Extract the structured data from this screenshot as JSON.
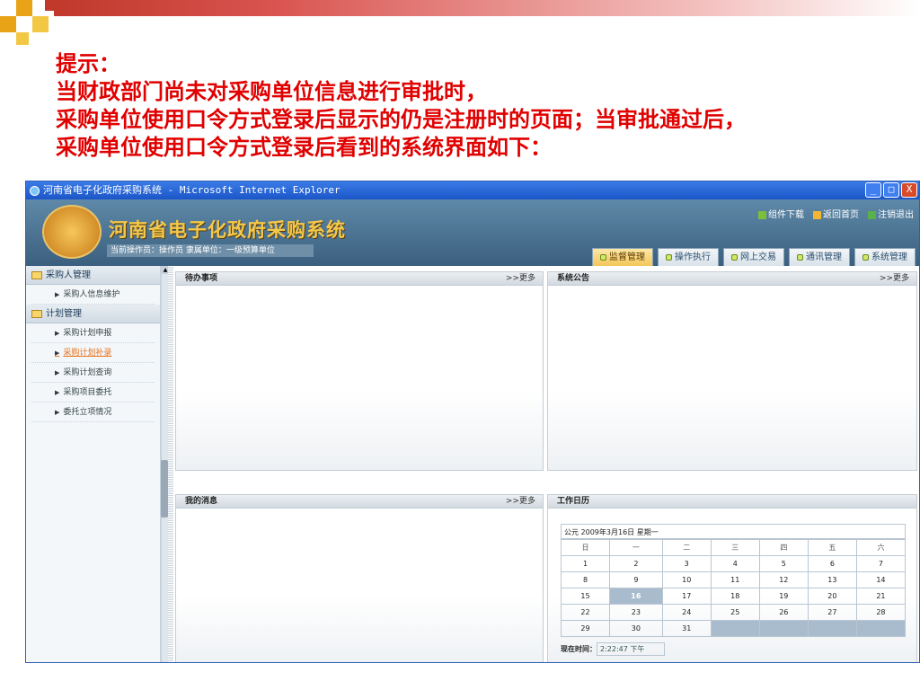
{
  "caption": {
    "line1": "提示：",
    "line2": "当财政部门尚未对采购单位信息进行审批时，",
    "line3": "采购单位使用口令方式登录后显示的仍是注册时的页面；当审批通过后，",
    "line4": "采购单位使用口令方式登录后看到的系统界面如下："
  },
  "window": {
    "title": "河南省电子化政府采购系统 - Microsoft Internet Explorer",
    "btn_min": "_",
    "btn_max": "□",
    "btn_close": "X"
  },
  "header": {
    "system_name": "河南省电子化政府采购系统",
    "operator_info": "当前操作员：操作员 隶属单位：一级预算单位",
    "links": {
      "download": "组件下载",
      "home": "返回首页",
      "logout": "注销退出"
    },
    "tabs": [
      {
        "label": "监督管理",
        "active": true
      },
      {
        "label": "操作执行",
        "active": false
      },
      {
        "label": "网上交易",
        "active": false
      },
      {
        "label": "通讯管理",
        "active": false
      },
      {
        "label": "系统管理",
        "active": false
      }
    ]
  },
  "sidebar": {
    "group1": "采购人管理",
    "group1_items": [
      "采购人信息维护"
    ],
    "group2": "计划管理",
    "group2_items": [
      "采购计划申报",
      "采购计划补录",
      "采购计划查询",
      "采购项目委托",
      "委托立项情况"
    ]
  },
  "panels": {
    "todo": {
      "title": "待办事项",
      "more": ">>更多"
    },
    "notice": {
      "title": "系统公告",
      "more": ">>更多"
    },
    "messages": {
      "title": "我的消息",
      "more": ">>更多"
    },
    "calendar": {
      "title": "工作日历"
    }
  },
  "calendar": {
    "header": "公元 2009年3月16日 星期一",
    "weekdays": [
      "日",
      "一",
      "二",
      "三",
      "四",
      "五",
      "六"
    ],
    "weeks": [
      [
        "1",
        "2",
        "3",
        "4",
        "5",
        "6",
        "7"
      ],
      [
        "8",
        "9",
        "10",
        "11",
        "12",
        "13",
        "14"
      ],
      [
        "15",
        "16",
        "17",
        "18",
        "19",
        "20",
        "21"
      ],
      [
        "22",
        "23",
        "24",
        "25",
        "26",
        "27",
        "28"
      ],
      [
        "29",
        "30",
        "31",
        "",
        "",
        "",
        ""
      ]
    ],
    "today": "16",
    "time_label": "现在时间：",
    "time_value": "2:22:47 下午"
  },
  "colors": {
    "caption": "#e00000",
    "accent_tab": "#f3c65a"
  }
}
